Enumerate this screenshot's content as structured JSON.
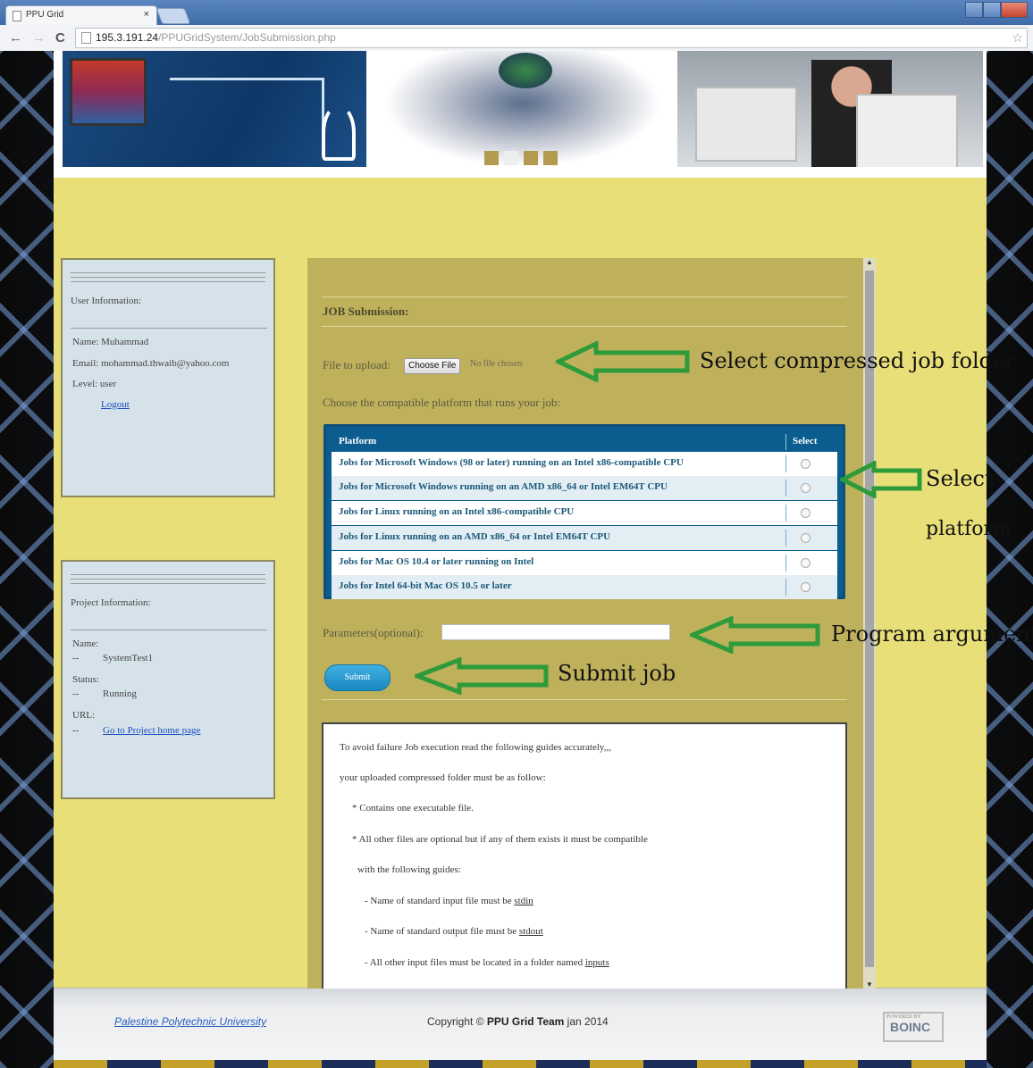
{
  "browser": {
    "tab_title": "PPU Grid",
    "tab_close": "×",
    "back": "←",
    "forward": "→",
    "reload": "C",
    "url_host": "195.3.191.24",
    "url_path": "/PPUGridSystem/JobSubmission.php",
    "star": "☆"
  },
  "user_info": {
    "title": "User Information:",
    "name": "Name: Muhammad",
    "email": "Email: mohammad.thwaib@yahoo.com",
    "level": "Level: user",
    "logout": "Logout"
  },
  "project_info": {
    "title": "Project Information:",
    "name_label": "Name:",
    "name_dash": "--",
    "name_value": "SystemTest1",
    "status_label": "Status:",
    "status_dash": "--",
    "status_value": "Running",
    "url_label": "URL:",
    "url_dash": "--",
    "url_link": "Go to Project home page"
  },
  "job": {
    "title": "JOB Submission:",
    "file_label": "File to upload:",
    "choose_file": "Choose File",
    "no_file": "No file chosen",
    "platform_prompt": "Choose the compatible platform that runs your job:",
    "table_headers": [
      "Platform",
      "Select"
    ],
    "platforms": [
      "Jobs for Microsoft Windows (98 or later) running on an Intel x86-compatible CPU",
      "Jobs for Microsoft Windows running on an AMD x86_64 or Intel EM64T CPU",
      "Jobs for Linux running on an Intel x86-compatible CPU",
      "Jobs for Linux running on an AMD x86_64 or Intel EM64T CPU",
      "Jobs for Mac OS 10.4 or later running on Intel",
      "Jobs for Intel 64-bit Mac OS 10.5 or later"
    ],
    "params_label": "Parameters(optional):",
    "params_value": "",
    "submit": "Submit"
  },
  "guide": {
    "line1": "To avoid failure Job execution read the following guides accurately,,,",
    "line2": "your uploaded compressed folder must be as follow:",
    "line3": "* Contains one executable file.",
    "line4": "* All other files are optional but if any of them exists it must be compatible",
    "line5": "with the following guides:",
    "line6_pre": "- Name of standard input file must be ",
    "line6_u": "stdin",
    "line7_pre": "- Name of standard output file must be ",
    "line7_u": "stdout",
    "line8_pre": "- All other input  files must be located in a folder named ",
    "line8_u": "inputs"
  },
  "annotations": {
    "file": "Select compressed job folder",
    "platform_1": "Select",
    "platform_2": "platform",
    "params": "Program arguments",
    "submit": "Submit job",
    "arrow_color": "#2e9b3a"
  },
  "footer": {
    "link": "Palestine Polytechnic University",
    "copyright_pre": "Copyright © ",
    "copyright_bold": "PPU Grid Team",
    "copyright_post": " jan 2014",
    "badge_top": "POWERED BY",
    "badge": "BOINC"
  }
}
